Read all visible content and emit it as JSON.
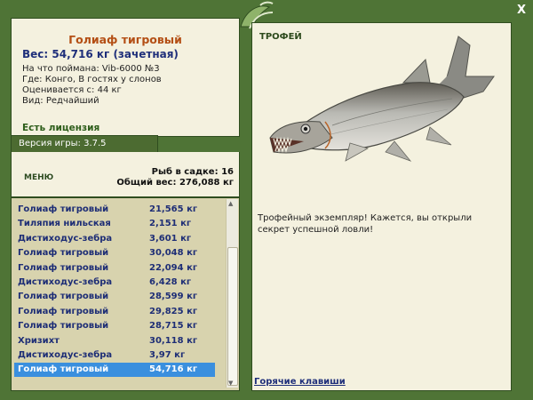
{
  "fish": {
    "name": "Голиаф тигровый",
    "weight": "Вес: 54,716 кг (зачетная)",
    "lure": "На что поймана: Vib-6000 №3",
    "where": "Где: Конго, В гостях у слонов",
    "value": "Оценивается с: 44 кг",
    "kind": "Вид: Редчайший"
  },
  "license": "Есть лицензия",
  "version": "Версия игры: 3.7.5",
  "menu_label": "МЕНЮ",
  "cage": {
    "count": "Рыб в садке: 16",
    "total": "Общий вес: 276,088 кг"
  },
  "catch_list": [
    {
      "name": "Голиаф тигровый",
      "weight": "21,565 кг"
    },
    {
      "name": "Тиляпия нильская",
      "weight": "2,151 кг"
    },
    {
      "name": "Дистиходус-зебра",
      "weight": "3,601 кг"
    },
    {
      "name": "Голиаф тигровый",
      "weight": "30,048 кг"
    },
    {
      "name": "Голиаф тигровый",
      "weight": "22,094 кг"
    },
    {
      "name": "Дистиходус-зебра",
      "weight": "6,428 кг"
    },
    {
      "name": "Голиаф тигровый",
      "weight": "28,599 кг"
    },
    {
      "name": "Голиаф тигровый",
      "weight": "29,825 кг"
    },
    {
      "name": "Голиаф тигровый",
      "weight": "28,715 кг"
    },
    {
      "name": "Хризихт",
      "weight": "30,118 кг"
    },
    {
      "name": "Дистиходус-зебра",
      "weight": "3,97 кг"
    },
    {
      "name": "Голиаф тигровый",
      "weight": "54,716 кг"
    }
  ],
  "selected_index": 11,
  "trophy": {
    "title": "ТРОФЕЙ",
    "text": "Трофейный экземпляр! Кажется, вы открыли секрет успешной ловли!"
  },
  "hotkeys": "Горячие клавиши",
  "close_glyph": "X",
  "colors": {
    "frame": "#4f7436",
    "panel": "#f4f1df",
    "list_bg": "#d8d3ae",
    "selection": "#3a8fde",
    "fish_name": "#b44f15",
    "text_blue": "#1f2f7a"
  }
}
